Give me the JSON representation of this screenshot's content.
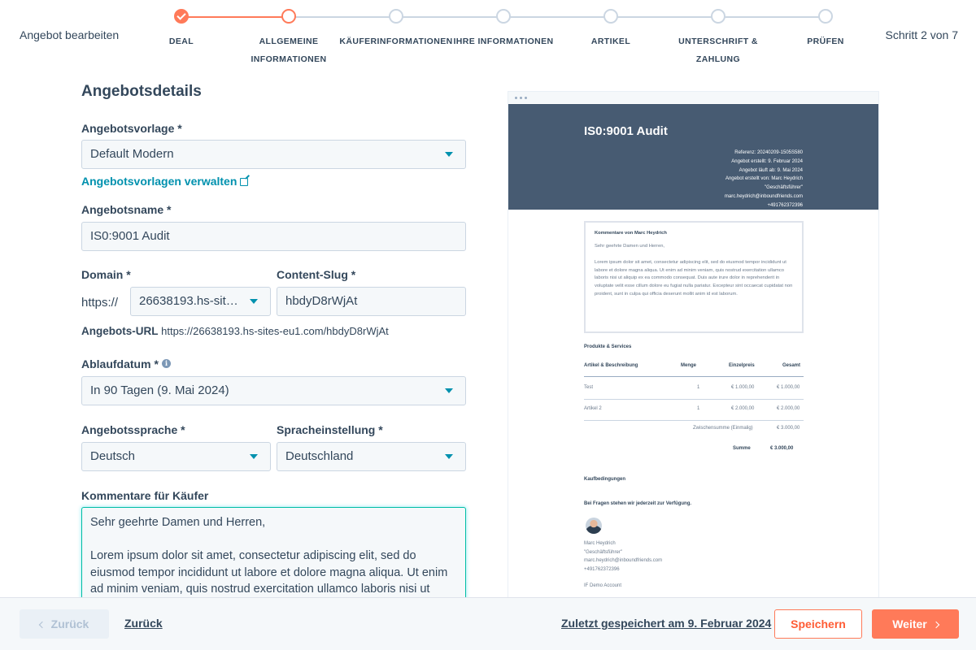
{
  "header": {
    "left_title": "Angebot bearbeiten",
    "step_counter": "Schritt 2 von 7",
    "steps": [
      {
        "label": "DEAL",
        "state": "done"
      },
      {
        "label": "ALLGEMEINE\nINFORMATIONEN",
        "state": "active"
      },
      {
        "label": "KÄUFERINFORMATIONEN",
        "state": "todo"
      },
      {
        "label": "IHRE INFORMATIONEN",
        "state": "todo"
      },
      {
        "label": "ARTIKEL",
        "state": "todo"
      },
      {
        "label": "UNTERSCHRIFT &\nZAHLUNG",
        "state": "todo"
      },
      {
        "label": "PRÜFEN",
        "state": "todo"
      }
    ]
  },
  "form": {
    "section_title": "Angebotsdetails",
    "template": {
      "label": "Angebotsvorlage *",
      "value": "Default Modern"
    },
    "manage_templates_link": "Angebotsvorlagen verwalten",
    "name": {
      "label": "Angebotsname *",
      "value": "IS0:9001 Audit"
    },
    "domain": {
      "label": "Domain *",
      "prefix": "https://",
      "value": "26638193.hs-sites-eu1.com"
    },
    "slug": {
      "label": "Content-Slug *",
      "value": "hbdyD8rWjAt"
    },
    "url": {
      "label": "Angebots-URL",
      "value": "https://26638193.hs-sites-eu1.com/hbdyD8rWjAt"
    },
    "expiry": {
      "label": "Ablaufdatum *",
      "value": "In 90 Tagen (9. Mai 2024)"
    },
    "language": {
      "label": "Angebotssprache *",
      "value": "Deutsch"
    },
    "locale": {
      "label": "Spracheinstellung *",
      "value": "Deutschland"
    },
    "comments": {
      "label": "Kommentare für Käufer",
      "value": "Sehr geehrte Damen und Herren,\n\nLorem ipsum dolor sit amet, consectetur adipiscing elit, sed do eiusmod tempor incididunt ut labore et dolore magna aliqua. Ut enim ad minim veniam, quis nostrud exercitation ullamco laboris nisi ut"
    }
  },
  "preview": {
    "title": "IS0:9001 Audit",
    "meta": [
      "Referenz: 20240209-1505S580",
      "Angebot erstellt: 9. Februar 2024",
      "Angebot läuft ab: 9. Mai 2024",
      "Angebot erstellt von: Marc Heydrich",
      "\"Geschäftsführer\"",
      "marc.heydrich@inboundfriends.com",
      "+491762372396"
    ],
    "comment_box": {
      "title": "Kommentare von Marc Heydrich",
      "greeting": "Sehr geehrte Damen und Herren,",
      "body": "Lorem ipsum dolor sit amet, consectetur adipiscing elit, sed do eiusmod tempor incididunt ut labore et dolore magna aliqua. Ut enim ad minim veniam, quis nostrud exercitation ullamco laboris nisi ut aliquip ex ea commodo consequat. Duis aute irure dolor in reprehenderit in voluptate velit esse cillum dolore eu fugiat nulla pariatur. Excepteur sint occaecat cupidatat non proident, sunt in culpa qui officia deserunt mollit anim id est laborum."
    },
    "products_title": "Produkte & Services",
    "table_headers": [
      "Artikel & Beschreibung",
      "Menge",
      "Einzelpreis",
      "Gesamt"
    ],
    "rows": [
      {
        "name": "Test",
        "qty": "1",
        "price": "€ 1.000,00",
        "total": "€ 1.000,00"
      },
      {
        "name": "Artikel 2",
        "qty": "1",
        "price": "€ 2.000,00",
        "total": "€ 2.000,00"
      }
    ],
    "subtotal_label": "Zwischensumme (Einmalig)",
    "subtotal_value": "€ 3.000,00",
    "sum_label": "Summe",
    "sum_value": "€ 3.000,00",
    "terms_title": "Kaufbedingungen",
    "contact_line": "Bei Fragen stehen wir jederzeit zur Verfügung.",
    "signature": [
      "Marc Heydrich",
      "\"Geschäftsführer\"",
      "marc.heydrich@inboundfriends.com",
      "+491762372396"
    ],
    "company": "IF Demo Account"
  },
  "footer": {
    "back_disabled": "Zurück",
    "back_link": "Zurück",
    "saved": "Zuletzt gespeichert am 9. Februar 2024",
    "save": "Speichern",
    "next": "Weiter"
  }
}
